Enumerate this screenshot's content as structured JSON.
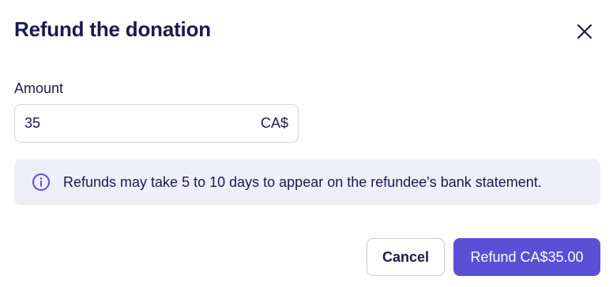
{
  "dialog": {
    "title": "Refund the donation",
    "close_icon": "close-icon"
  },
  "amount": {
    "label": "Amount",
    "value": "35",
    "currency": "CA$"
  },
  "info": {
    "icon": "info-icon",
    "text": "Refunds may take 5 to 10 days to appear on the refundee's bank statement."
  },
  "actions": {
    "cancel_label": "Cancel",
    "refund_label": "Refund CA$35.00"
  },
  "colors": {
    "primary": "#5a50d6",
    "text": "#1b1a4e",
    "banner_bg": "#efeffa"
  }
}
